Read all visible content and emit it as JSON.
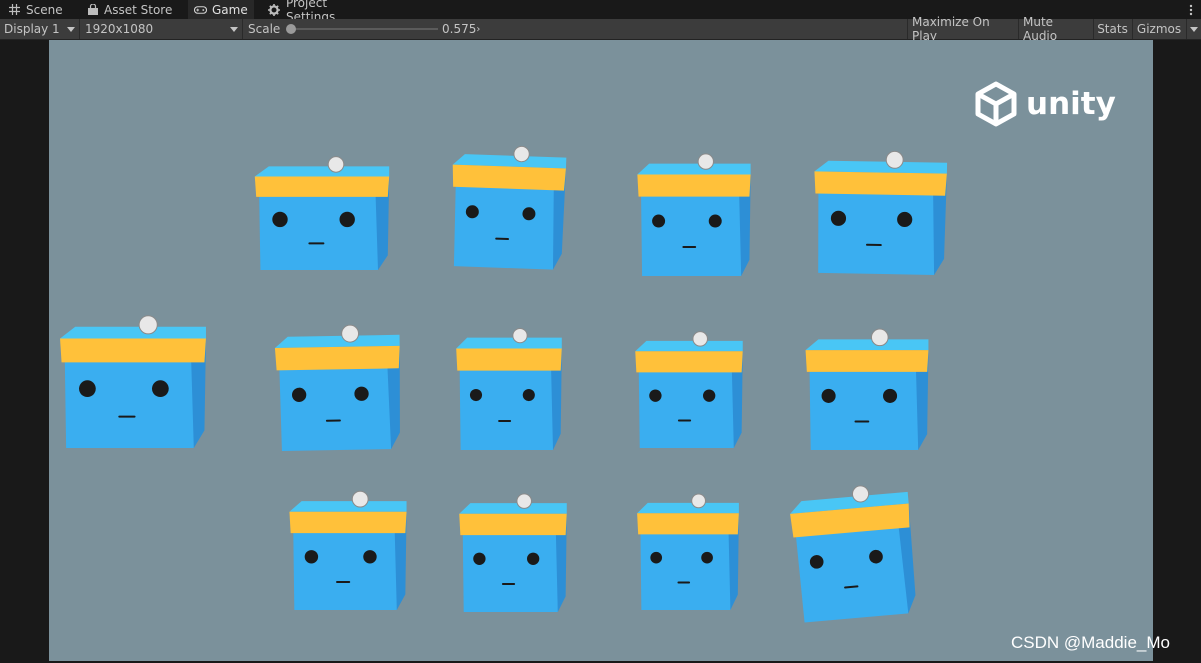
{
  "tabs": [
    {
      "label": "Scene",
      "icon": "grid-icon",
      "active": false
    },
    {
      "label": "Asset Store",
      "icon": "bag-icon",
      "active": false
    },
    {
      "label": "Game",
      "icon": "gamepad-icon",
      "active": true
    },
    {
      "label": "Project Settings",
      "icon": "gear-icon",
      "active": false
    }
  ],
  "toolbar": {
    "display": "Display 1",
    "resolution": "1920x1080",
    "scale_label": "Scale",
    "scale_value": "0.575",
    "scale_fraction": 0.0,
    "maximize": "Maximize On Play",
    "mute": "Mute Audio",
    "stats": "Stats",
    "gizmos": "Gizmos"
  },
  "game": {
    "background": "#7b919b",
    "logo_text": "unity",
    "box_colors": {
      "body": "#3aaef0",
      "side": "#2d8fd6",
      "lid": "#49c6f5",
      "band": "#ffc13a",
      "ball": "#e8e8e8"
    }
  },
  "watermark": "CSDN @Maddie_Mo"
}
